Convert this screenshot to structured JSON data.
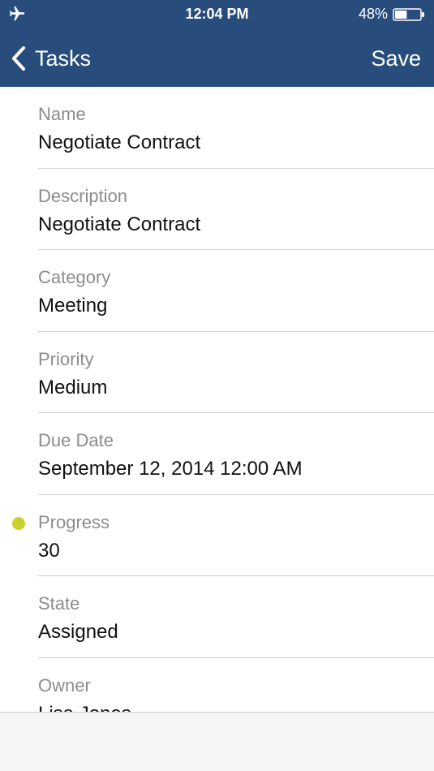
{
  "status_bar": {
    "time": "12:04 PM",
    "battery_percent": "48%",
    "battery_level": 0.48,
    "airplane_icon": "airplane-icon",
    "battery_icon": "battery-icon"
  },
  "nav": {
    "back_label": "Tasks",
    "back_icon": "chevron-left-icon",
    "save_label": "Save"
  },
  "fields": [
    {
      "label": "Name",
      "value": "Negotiate Contract"
    },
    {
      "label": "Description",
      "value": "Negotiate Contract"
    },
    {
      "label": "Category",
      "value": "Meeting"
    },
    {
      "label": "Priority",
      "value": "Medium"
    },
    {
      "label": "Due Date",
      "value": "September 12, 2014 12:00 AM"
    },
    {
      "label": "Progress",
      "value": "30"
    },
    {
      "label": "State",
      "value": "Assigned"
    },
    {
      "label": "Owner",
      "value": "Lisa Jones"
    }
  ],
  "colors": {
    "nav_background": "#284d7d",
    "progress_indicator": "#c9d12c"
  }
}
